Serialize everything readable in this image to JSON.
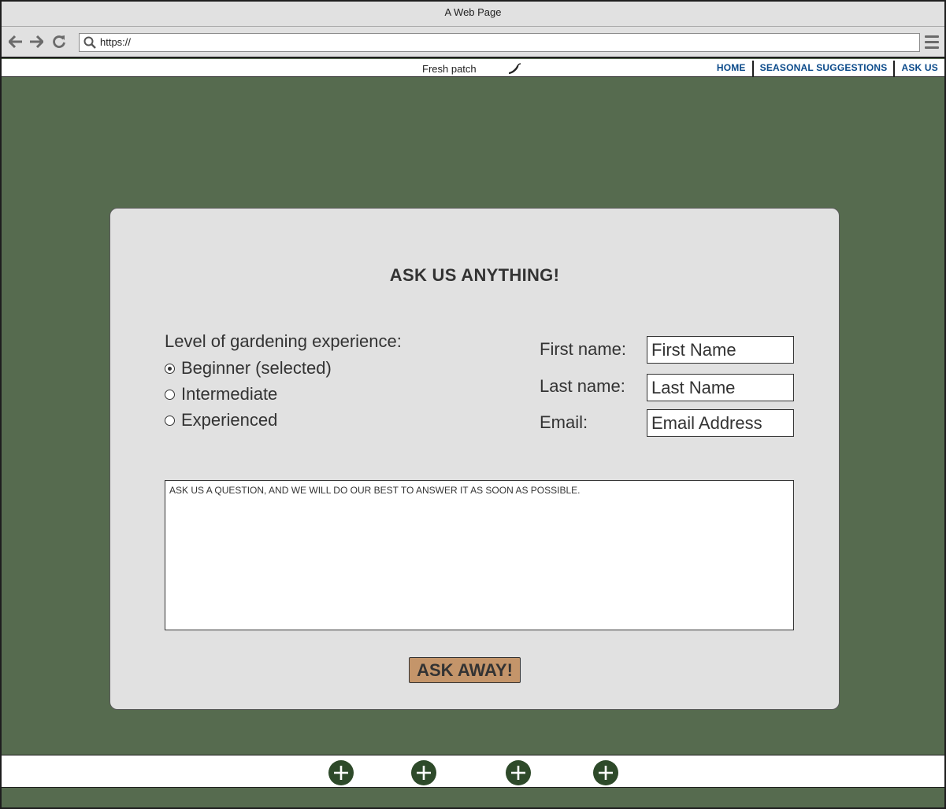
{
  "window": {
    "title": "A Web Page"
  },
  "browser": {
    "url": "https://",
    "icons": {
      "back": "arrow-left-icon",
      "forward": "arrow-right-icon",
      "reload": "reload-icon",
      "search": "search-icon",
      "menu": "hamburger-menu-icon"
    }
  },
  "header": {
    "brand": "Fresh patch",
    "brand_icon": "chili-pepper-icon",
    "nav": [
      "HOME",
      "SEASONAL SUGGESTIONS",
      "ASK US"
    ]
  },
  "form": {
    "title": "ASK US ANYTHING!",
    "experience": {
      "legend": "Level of gardening experience:",
      "options": [
        {
          "label": "Beginner (selected)",
          "selected": true
        },
        {
          "label": "Intermediate",
          "selected": false
        },
        {
          "label": "Experienced",
          "selected": false
        }
      ]
    },
    "fields": {
      "first_name": {
        "label": "First name:",
        "placeholder": "First Name"
      },
      "last_name": {
        "label": "Last name:",
        "placeholder": "Last Name"
      },
      "email": {
        "label": "Email:",
        "placeholder": "Email Address"
      }
    },
    "question_placeholder": "ASK US A QUESTION, AND WE WILL DO OUR BEST TO ANSWER IT AS SOON AS POSSIBLE.",
    "submit_label": "ASK AWAY!"
  },
  "footer": {
    "social_icons": [
      "plus-icon",
      "plus-icon",
      "plus-icon",
      "plus-icon"
    ]
  },
  "colors": {
    "background": "#566b4f",
    "card": "#e1e1e1",
    "nav_link": "#0b4a8a",
    "button": "#c4956a",
    "social_icon": "#2e4a2a"
  }
}
